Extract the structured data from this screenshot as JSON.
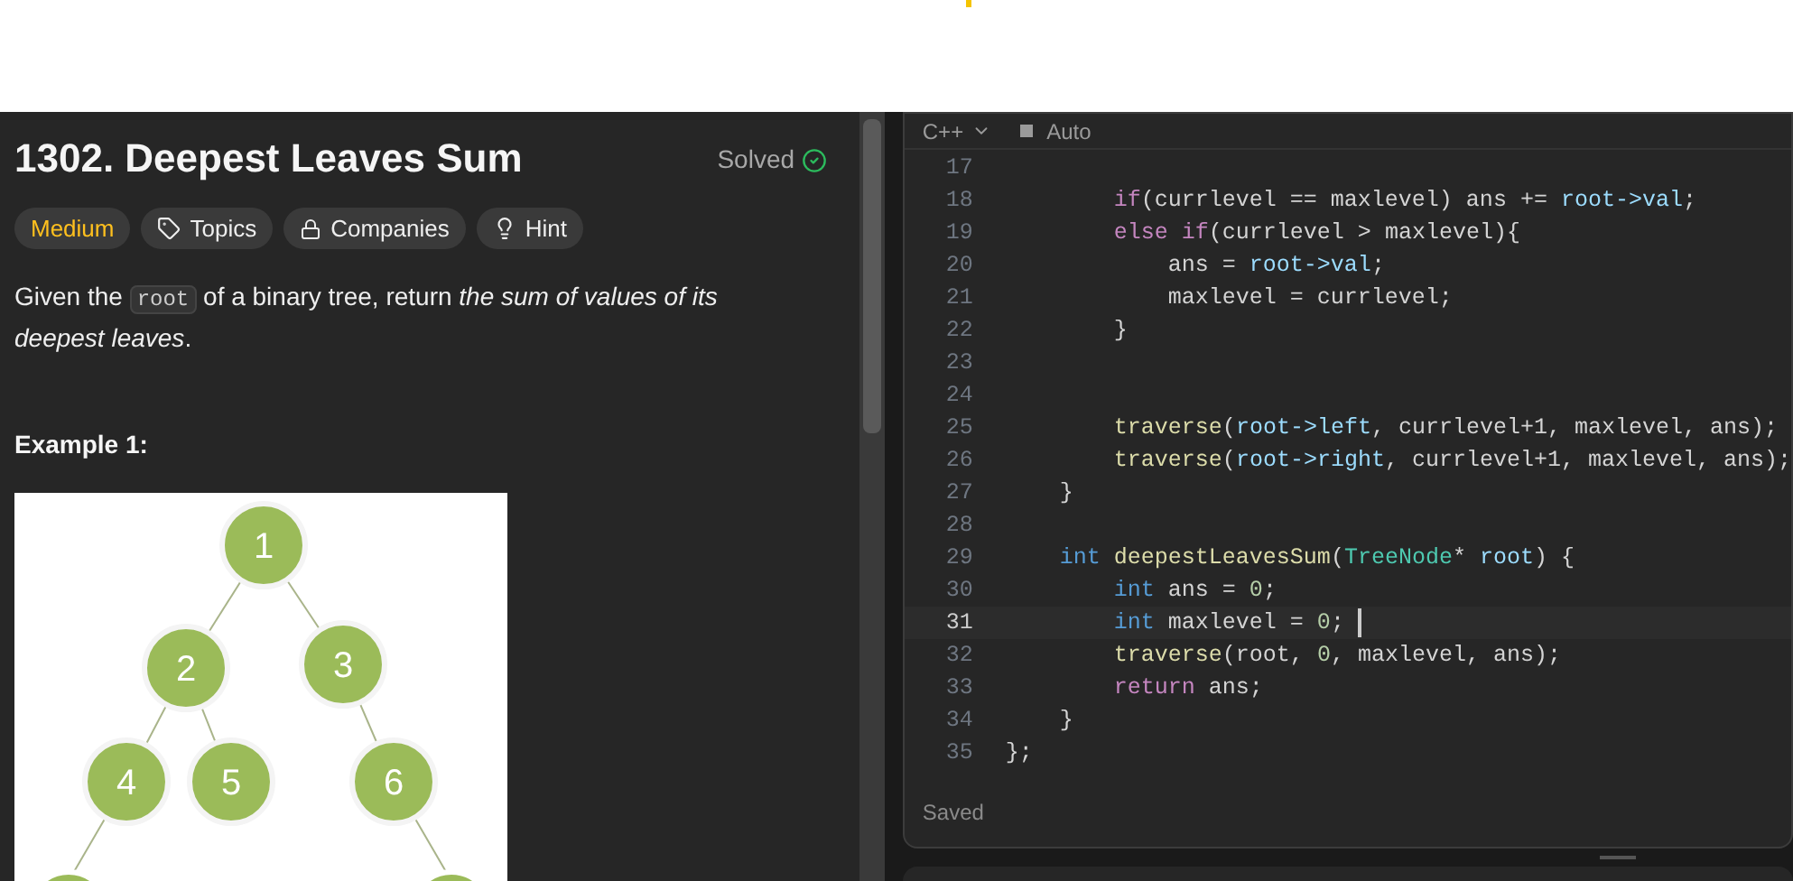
{
  "problem": {
    "title": "1302. Deepest Leaves Sum",
    "status": "Solved",
    "difficulty": "Medium",
    "tags": [
      {
        "kind": "topics",
        "label": "Topics"
      },
      {
        "kind": "companies",
        "label": "Companies"
      },
      {
        "kind": "hint",
        "label": "Hint"
      }
    ],
    "description": [
      {
        "kind": "text",
        "text": "Given the "
      },
      {
        "kind": "code",
        "text": "root"
      },
      {
        "kind": "text",
        "text": " of a binary tree, return "
      },
      {
        "kind": "italic",
        "text": "the sum of values of its deepest leaves"
      },
      {
        "kind": "text",
        "text": "."
      }
    ],
    "example_title": "Example 1:",
    "tree_nodes": [
      "1",
      "2",
      "3",
      "4",
      "5",
      "6"
    ]
  },
  "editor": {
    "language": "C++",
    "mode": "Auto",
    "status": "Saved",
    "lines": [
      {
        "number": "17",
        "current": false
      },
      {
        "number": "18",
        "current": false,
        "tokens": [
          {
            "kind": "keyword",
            "text": "        if"
          },
          {
            "kind": "plain",
            "text": "(currlevel == maxlevel) ans += "
          },
          {
            "kind": "var",
            "text": "root->val"
          },
          {
            "kind": "plain",
            "text": ";"
          }
        ]
      },
      {
        "number": "19",
        "current": false,
        "tokens": [
          {
            "kind": "keyword",
            "text": "        else if"
          },
          {
            "kind": "plain",
            "text": "(currlevel > maxlevel){"
          }
        ]
      },
      {
        "number": "20",
        "current": false,
        "tokens": [
          {
            "kind": "plain",
            "text": "            ans = "
          },
          {
            "kind": "var",
            "text": "root->val"
          },
          {
            "kind": "plain",
            "text": ";"
          }
        ]
      },
      {
        "number": "21",
        "current": false,
        "tokens": [
          {
            "kind": "plain",
            "text": "            maxlevel = currlevel;"
          }
        ]
      },
      {
        "number": "22",
        "current": false,
        "tokens": [
          {
            "kind": "plain",
            "text": "        }"
          }
        ]
      },
      {
        "number": "23",
        "current": false
      },
      {
        "number": "24",
        "current": false
      },
      {
        "number": "25",
        "current": false,
        "tokens": [
          {
            "kind": "fn",
            "text": "        traverse"
          },
          {
            "kind": "plain",
            "text": "("
          },
          {
            "kind": "var",
            "text": "root->left"
          },
          {
            "kind": "plain",
            "text": ", currlevel+1, maxlevel, ans);"
          }
        ]
      },
      {
        "number": "26",
        "current": false,
        "tokens": [
          {
            "kind": "fn",
            "text": "        traverse"
          },
          {
            "kind": "plain",
            "text": "("
          },
          {
            "kind": "var",
            "text": "root->right"
          },
          {
            "kind": "plain",
            "text": ", currlevel+1, maxlevel, ans);"
          }
        ]
      },
      {
        "number": "27",
        "current": false,
        "tokens": [
          {
            "kind": "plain",
            "text": "    }"
          }
        ]
      },
      {
        "number": "28",
        "current": false
      },
      {
        "number": "29",
        "current": false,
        "tokens": [
          {
            "kind": "type",
            "text": "    int "
          },
          {
            "kind": "fn",
            "text": "deepestLeavesSum"
          },
          {
            "kind": "plain",
            "text": "("
          },
          {
            "kind": "class",
            "text": "TreeNode"
          },
          {
            "kind": "plain",
            "text": "* "
          },
          {
            "kind": "var",
            "text": "root"
          },
          {
            "kind": "plain",
            "text": ") {"
          }
        ]
      },
      {
        "number": "30",
        "current": false,
        "tokens": [
          {
            "kind": "type",
            "text": "        int "
          },
          {
            "kind": "plain",
            "text": "ans = "
          },
          {
            "kind": "number",
            "text": "0"
          },
          {
            "kind": "plain",
            "text": ";"
          }
        ]
      },
      {
        "number": "31",
        "current": true,
        "tokens": [
          {
            "kind": "type",
            "text": "        int "
          },
          {
            "kind": "plain",
            "text": "maxlevel = "
          },
          {
            "kind": "number",
            "text": "0"
          },
          {
            "kind": "plain",
            "text": ";"
          }
        ]
      },
      {
        "number": "32",
        "current": false,
        "tokens": [
          {
            "kind": "fn",
            "text": "        traverse"
          },
          {
            "kind": "plain",
            "text": "(root, "
          },
          {
            "kind": "number",
            "text": "0"
          },
          {
            "kind": "plain",
            "text": ", maxlevel, ans);"
          }
        ]
      },
      {
        "number": "33",
        "current": false,
        "tokens": [
          {
            "kind": "keyword",
            "text": "        return "
          },
          {
            "kind": "plain",
            "text": "ans;"
          }
        ]
      },
      {
        "number": "34",
        "current": false,
        "tokens": [
          {
            "kind": "plain",
            "text": "    }"
          }
        ]
      },
      {
        "number": "35",
        "current": false,
        "tokens": [
          {
            "kind": "plain",
            "text": "};"
          }
        ]
      }
    ]
  }
}
